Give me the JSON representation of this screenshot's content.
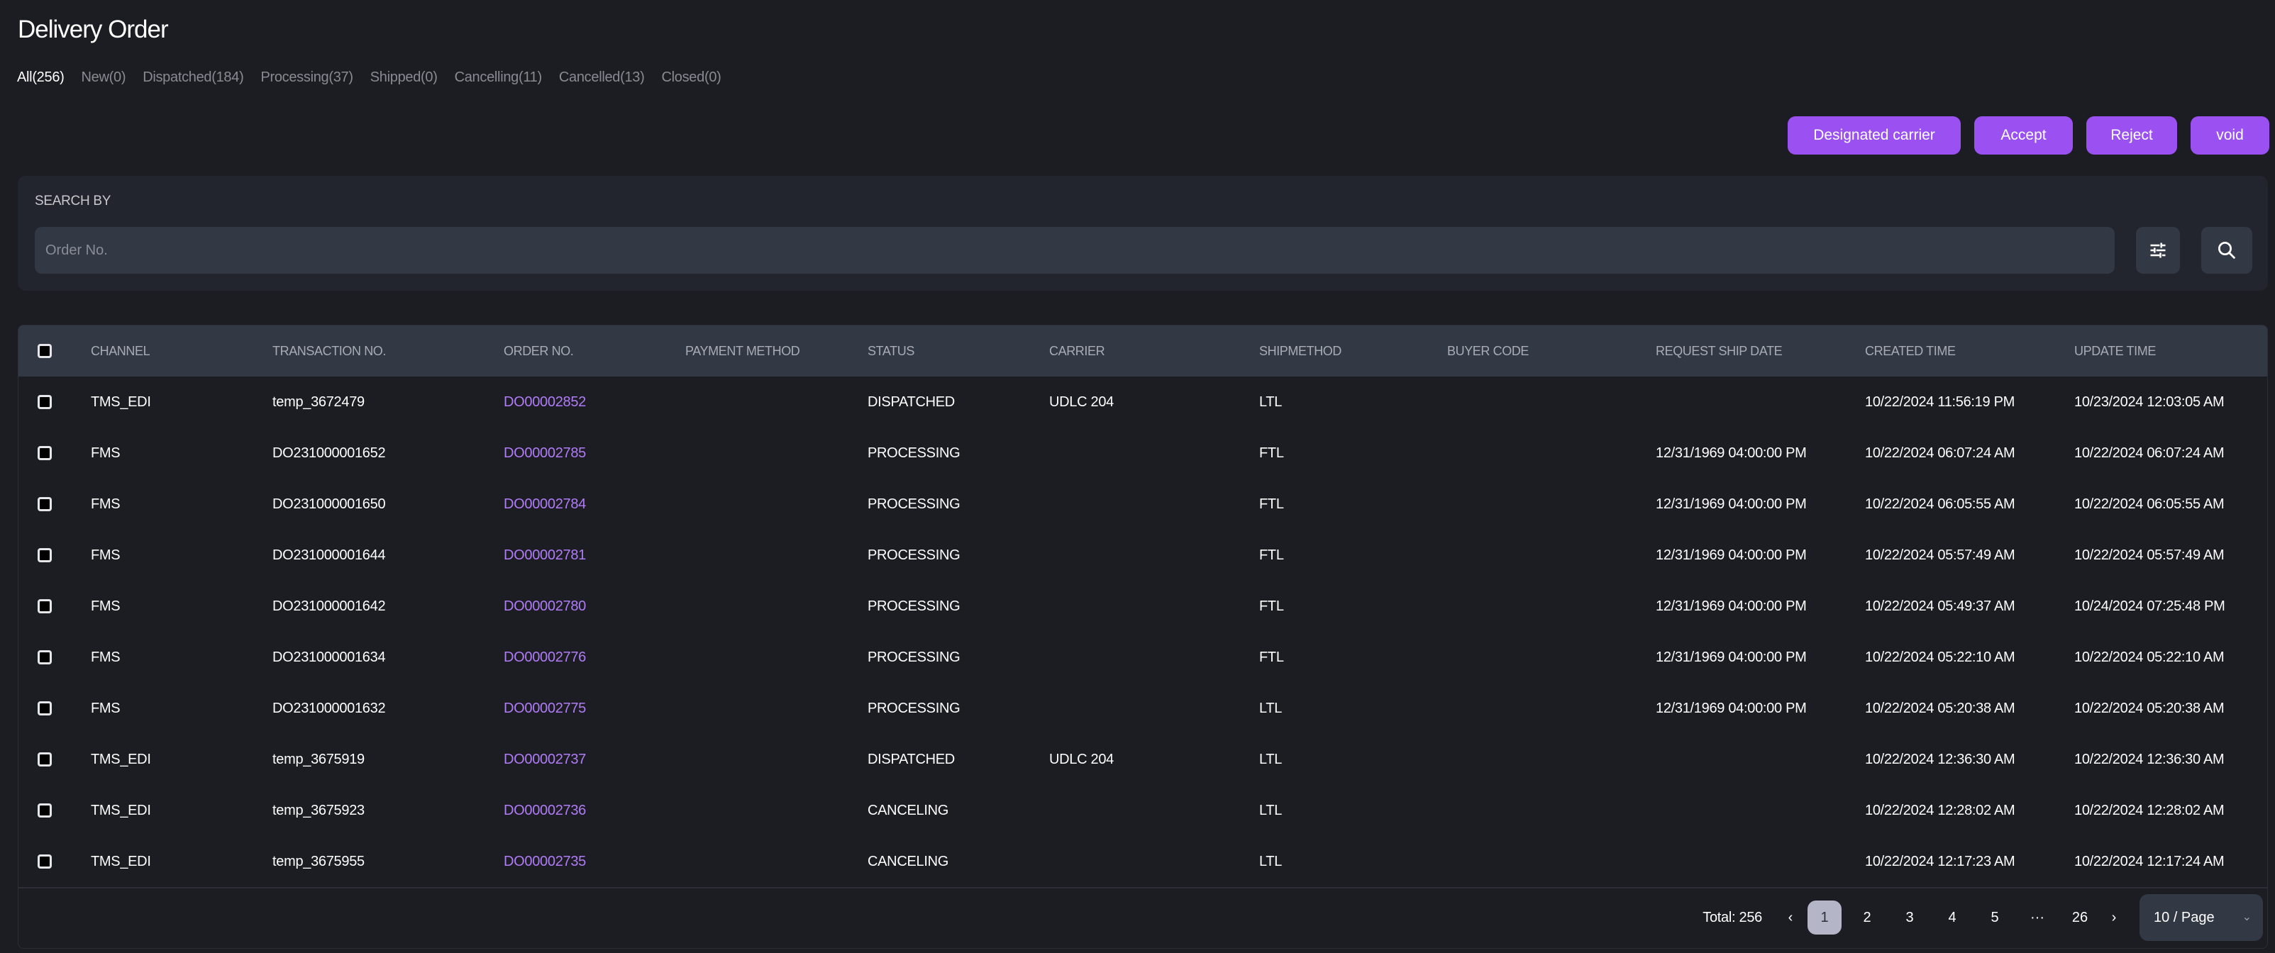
{
  "header": {
    "title": "Delivery Order"
  },
  "tabs": [
    {
      "label": "All(256)",
      "active": true
    },
    {
      "label": "New(0)",
      "active": false
    },
    {
      "label": "Dispatched(184)",
      "active": false
    },
    {
      "label": "Processing(37)",
      "active": false
    },
    {
      "label": "Shipped(0)",
      "active": false
    },
    {
      "label": "Cancelling(11)",
      "active": false
    },
    {
      "label": "Cancelled(13)",
      "active": false
    },
    {
      "label": "Closed(0)",
      "active": false
    }
  ],
  "actions": {
    "designated_carrier": "Designated carrier",
    "accept": "Accept",
    "reject": "Reject",
    "void": "void"
  },
  "search": {
    "label": "SEARCH BY",
    "placeholder": "Order No.",
    "value": "",
    "filter_icon": "sliders-icon",
    "search_icon": "search-icon"
  },
  "table": {
    "columns": [
      "CHANNEL",
      "TRANSACTION NO.",
      "ORDER NO.",
      "PAYMENT METHOD",
      "STATUS",
      "CARRIER",
      "SHIPMETHOD",
      "BUYER CODE",
      "REQUEST SHIP DATE",
      "CREATED TIME",
      "UPDATE TIME"
    ],
    "rows": [
      {
        "channel": "TMS_EDI",
        "transaction_no": "temp_3672479",
        "order_no": "DO00002852",
        "payment_method": "",
        "status": "DISPATCHED",
        "carrier": "UDLC 204",
        "shipmethod": "LTL",
        "buyer_code": "",
        "request_ship_date": "",
        "created_time": "10/22/2024 11:56:19 PM",
        "update_time": "10/23/2024 12:03:05 AM"
      },
      {
        "channel": "FMS",
        "transaction_no": "DO231000001652",
        "order_no": "DO00002785",
        "payment_method": "",
        "status": "PROCESSING",
        "carrier": "",
        "shipmethod": "FTL",
        "buyer_code": "",
        "request_ship_date": "12/31/1969 04:00:00 PM",
        "created_time": "10/22/2024 06:07:24 AM",
        "update_time": "10/22/2024 06:07:24 AM"
      },
      {
        "channel": "FMS",
        "transaction_no": "DO231000001650",
        "order_no": "DO00002784",
        "payment_method": "",
        "status": "PROCESSING",
        "carrier": "",
        "shipmethod": "FTL",
        "buyer_code": "",
        "request_ship_date": "12/31/1969 04:00:00 PM",
        "created_time": "10/22/2024 06:05:55 AM",
        "update_time": "10/22/2024 06:05:55 AM"
      },
      {
        "channel": "FMS",
        "transaction_no": "DO231000001644",
        "order_no": "DO00002781",
        "payment_method": "",
        "status": "PROCESSING",
        "carrier": "",
        "shipmethod": "FTL",
        "buyer_code": "",
        "request_ship_date": "12/31/1969 04:00:00 PM",
        "created_time": "10/22/2024 05:57:49 AM",
        "update_time": "10/22/2024 05:57:49 AM"
      },
      {
        "channel": "FMS",
        "transaction_no": "DO231000001642",
        "order_no": "DO00002780",
        "payment_method": "",
        "status": "PROCESSING",
        "carrier": "",
        "shipmethod": "FTL",
        "buyer_code": "",
        "request_ship_date": "12/31/1969 04:00:00 PM",
        "created_time": "10/22/2024 05:49:37 AM",
        "update_time": "10/24/2024 07:25:48 PM"
      },
      {
        "channel": "FMS",
        "transaction_no": "DO231000001634",
        "order_no": "DO00002776",
        "payment_method": "",
        "status": "PROCESSING",
        "carrier": "",
        "shipmethod": "FTL",
        "buyer_code": "",
        "request_ship_date": "12/31/1969 04:00:00 PM",
        "created_time": "10/22/2024 05:22:10 AM",
        "update_time": "10/22/2024 05:22:10 AM"
      },
      {
        "channel": "FMS",
        "transaction_no": "DO231000001632",
        "order_no": "DO00002775",
        "payment_method": "",
        "status": "PROCESSING",
        "carrier": "",
        "shipmethod": "LTL",
        "buyer_code": "",
        "request_ship_date": "12/31/1969 04:00:00 PM",
        "created_time": "10/22/2024 05:20:38 AM",
        "update_time": "10/22/2024 05:20:38 AM"
      },
      {
        "channel": "TMS_EDI",
        "transaction_no": "temp_3675919",
        "order_no": "DO00002737",
        "payment_method": "",
        "status": "DISPATCHED",
        "carrier": "UDLC 204",
        "shipmethod": "LTL",
        "buyer_code": "",
        "request_ship_date": "",
        "created_time": "10/22/2024 12:36:30 AM",
        "update_time": "10/22/2024 12:36:30 AM"
      },
      {
        "channel": "TMS_EDI",
        "transaction_no": "temp_3675923",
        "order_no": "DO00002736",
        "payment_method": "",
        "status": "CANCELING",
        "carrier": "",
        "shipmethod": "LTL",
        "buyer_code": "",
        "request_ship_date": "",
        "created_time": "10/22/2024 12:28:02 AM",
        "update_time": "10/22/2024 12:28:02 AM"
      },
      {
        "channel": "TMS_EDI",
        "transaction_no": "temp_3675955",
        "order_no": "DO00002735",
        "payment_method": "",
        "status": "CANCELING",
        "carrier": "",
        "shipmethod": "LTL",
        "buyer_code": "",
        "request_ship_date": "",
        "created_time": "10/22/2024 12:17:23 AM",
        "update_time": "10/22/2024 12:17:24 AM"
      }
    ]
  },
  "pagination": {
    "total_label": "Total: 256",
    "prev_icon": "‹",
    "next_icon": "›",
    "pages": [
      "1",
      "2",
      "3",
      "4",
      "5",
      "···",
      "26"
    ],
    "current_page": "1",
    "page_size": "10 / Page",
    "page_size_chevron": "⌄"
  },
  "colors": {
    "accent": "#9b51f2",
    "link": "#b07cf7",
    "background": "#1c1c23",
    "panel": "#23252e",
    "header_row": "#333845"
  }
}
